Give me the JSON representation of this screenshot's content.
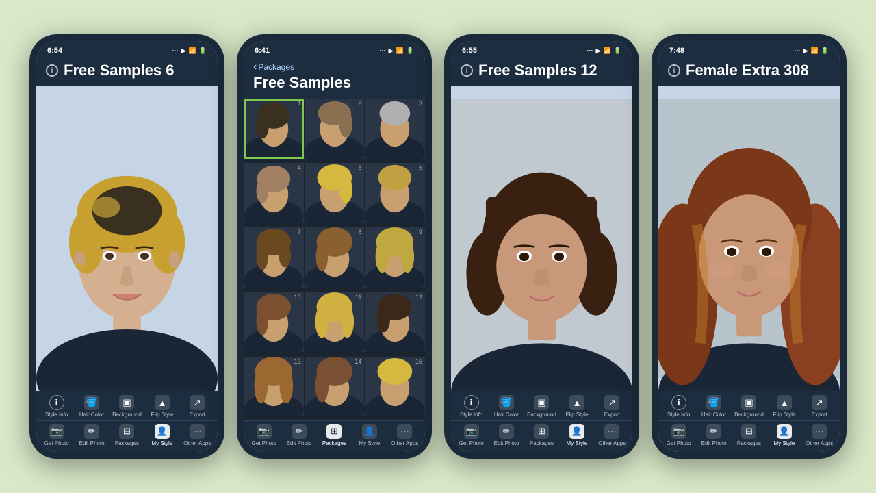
{
  "background": "#d8e8c8",
  "phones": [
    {
      "id": "phone1",
      "time": "6:54",
      "title": "Free Samples 6",
      "hasBack": false,
      "backLabel": "",
      "screenType": "single",
      "accentColor": "#7ec850",
      "toolbars": {
        "top": [
          {
            "icon": "ℹ",
            "label": "Style Info",
            "circle": true,
            "active": false
          },
          {
            "icon": "🪣",
            "label": "Hair Color",
            "circle": false,
            "active": false
          },
          {
            "icon": "🖼",
            "label": "Background",
            "circle": false,
            "active": false
          },
          {
            "icon": "▲",
            "label": "Flip Style",
            "circle": false,
            "active": false
          },
          {
            "icon": "↗",
            "label": "Export",
            "circle": false,
            "active": false
          }
        ],
        "bottom": [
          {
            "icon": "📷",
            "label": "Get Photo",
            "circle": false,
            "active": false
          },
          {
            "icon": "✏",
            "label": "Edit Photo",
            "circle": false,
            "active": false
          },
          {
            "icon": "📦",
            "label": "Packages",
            "circle": false,
            "active": false
          },
          {
            "icon": "👤",
            "label": "My Style",
            "circle": false,
            "active": true
          },
          {
            "icon": "⋯",
            "label": "Other Apps",
            "circle": false,
            "active": false
          }
        ]
      }
    },
    {
      "id": "phone2",
      "time": "6:41",
      "title": "Free Samples",
      "hasBack": true,
      "backLabel": "Packages",
      "screenType": "grid",
      "accentColor": "#7ec850",
      "gridCount": 15,
      "toolbars": {
        "top": [],
        "bottom": [
          {
            "icon": "📷",
            "label": "Get Photo",
            "circle": false,
            "active": false
          },
          {
            "icon": "✏",
            "label": "Edit Photo",
            "circle": false,
            "active": false
          },
          {
            "icon": "📦",
            "label": "Packages",
            "circle": false,
            "active": true
          },
          {
            "icon": "👤",
            "label": "My Style",
            "circle": false,
            "active": false
          },
          {
            "icon": "⋯",
            "label": "Other Apps",
            "circle": false,
            "active": false
          }
        ]
      }
    },
    {
      "id": "phone3",
      "time": "6:55",
      "title": "Free Samples 12",
      "hasBack": false,
      "backLabel": "",
      "screenType": "single",
      "accentColor": "#7ec850",
      "toolbars": {
        "top": [
          {
            "icon": "ℹ",
            "label": "Style Info",
            "circle": true,
            "active": false
          },
          {
            "icon": "🪣",
            "label": "Hair Color",
            "circle": false,
            "active": false
          },
          {
            "icon": "🖼",
            "label": "Background",
            "circle": false,
            "active": false
          },
          {
            "icon": "▲",
            "label": "Flip Style",
            "circle": false,
            "active": false
          },
          {
            "icon": "↗",
            "label": "Export",
            "circle": false,
            "active": false
          }
        ],
        "bottom": [
          {
            "icon": "📷",
            "label": "Get Photo",
            "circle": false,
            "active": false
          },
          {
            "icon": "✏",
            "label": "Edit Photo",
            "circle": false,
            "active": false
          },
          {
            "icon": "📦",
            "label": "Packages",
            "circle": false,
            "active": false
          },
          {
            "icon": "👤",
            "label": "My Style",
            "circle": false,
            "active": true
          },
          {
            "icon": "⋯",
            "label": "Other Apps",
            "circle": false,
            "active": false
          }
        ]
      }
    },
    {
      "id": "phone4",
      "time": "7:48",
      "title": "Female Extra 308",
      "hasBack": false,
      "backLabel": "",
      "screenType": "single",
      "accentColor": "#7ec850",
      "toolbars": {
        "top": [
          {
            "icon": "ℹ",
            "label": "Style Info",
            "circle": true,
            "active": false
          },
          {
            "icon": "🪣",
            "label": "Hair Color",
            "circle": false,
            "active": false
          },
          {
            "icon": "🖼",
            "label": "Background",
            "circle": false,
            "active": false
          },
          {
            "icon": "▲",
            "label": "Flip Style",
            "circle": false,
            "active": false
          },
          {
            "icon": "↗",
            "label": "Export",
            "circle": false,
            "active": false
          }
        ],
        "bottom": [
          {
            "icon": "📷",
            "label": "Get Photo",
            "circle": false,
            "active": false
          },
          {
            "icon": "✏",
            "label": "Edit Photo",
            "circle": false,
            "active": false
          },
          {
            "icon": "📦",
            "label": "Packages",
            "circle": false,
            "active": false
          },
          {
            "icon": "👤",
            "label": "My Style",
            "circle": false,
            "active": true
          },
          {
            "icon": "⋯",
            "label": "Other Apps",
            "circle": false,
            "active": false
          }
        ]
      }
    }
  ]
}
